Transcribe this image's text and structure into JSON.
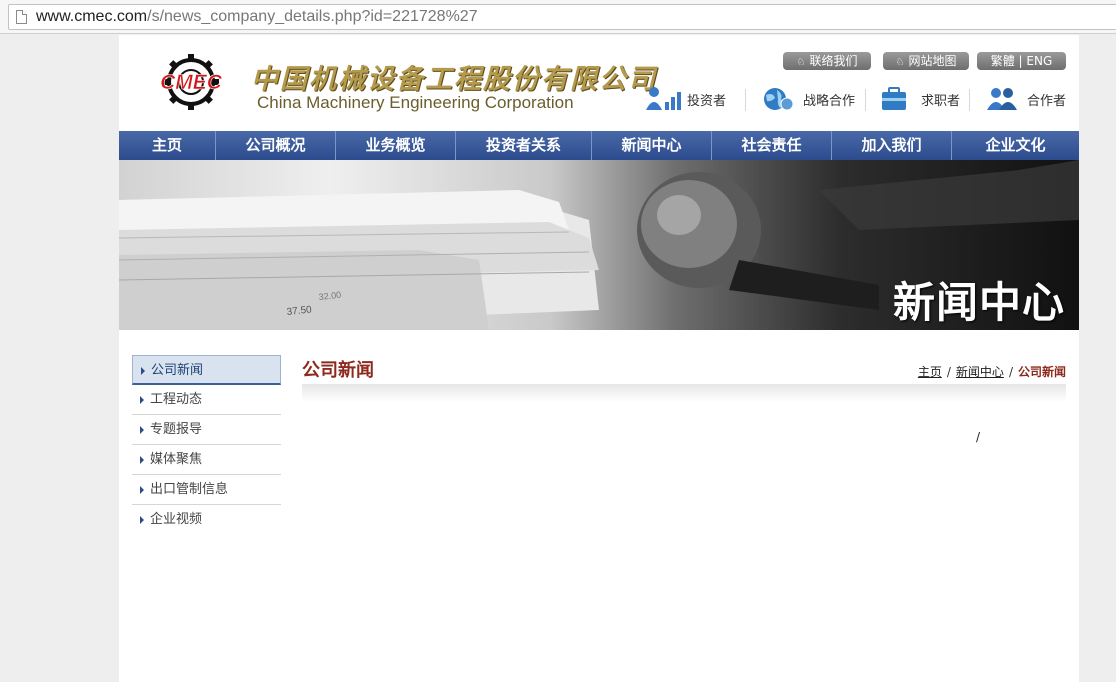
{
  "browser": {
    "url_host": "www.cmec.com",
    "url_rest": "/s/news_company_details.php?id=221728%27"
  },
  "header": {
    "brand_cn": "中国机械设备工程股份有限公司",
    "brand_en": "China Machinery Engineering Corporation",
    "logo_text": "CMEC",
    "util_links": {
      "contact": "联络我们",
      "sitemap": "网站地图",
      "lang": "繁體 | ENG"
    },
    "quick_links": {
      "investor": "投资者",
      "strategy": "战略合作",
      "jobs": "求职者",
      "partner": "合作者"
    }
  },
  "nav": {
    "items": [
      "主页",
      "公司概况",
      "业务概览",
      "投资者关系",
      "新闻中心",
      "社会责任",
      "加入我们",
      "企业文化"
    ]
  },
  "banner": {
    "title": "新闻中心",
    "paper_numbers": [
      "37.50",
      "32.00"
    ]
  },
  "sidebar": {
    "items": [
      "公司新闻",
      "工程动态",
      "专题报导",
      "媒体聚焦",
      "出口管制信息",
      "企业视频"
    ]
  },
  "content": {
    "title": "公司新闻",
    "breadcrumb": {
      "home": "主页",
      "section": "新闻中心",
      "current": "公司新闻",
      "separator": "/"
    },
    "body_text": "/"
  },
  "colors": {
    "nav_blue": "#2d4c8d",
    "title_red": "#8e2a1d",
    "logo_red": "#d3161c",
    "brand_gold": "#b39a4c"
  }
}
